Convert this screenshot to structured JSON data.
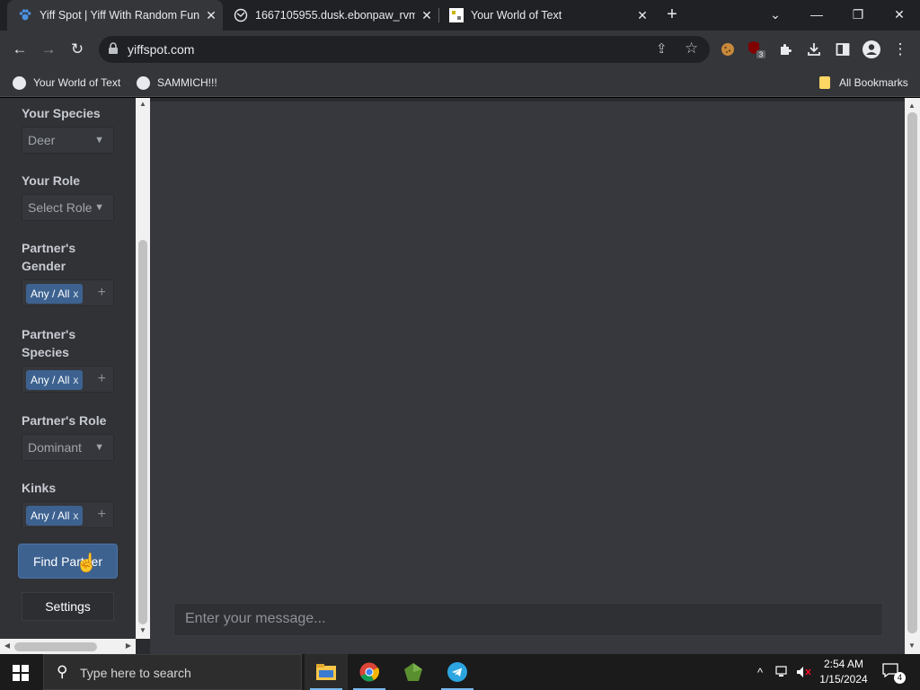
{
  "browser": {
    "tabs": [
      {
        "title": "Yiff Spot | Yiff With Random Fun",
        "icon": "paw-icon",
        "active": true
      },
      {
        "title": "1667105955.dusk.ebonpaw_rvm",
        "icon": "site-icon",
        "active": false
      },
      {
        "title": "Your World of Text",
        "icon": "ywot-icon",
        "active": false
      }
    ],
    "url": "yiffspot.com",
    "bookmarks": [
      {
        "label": "Your World of Text"
      },
      {
        "label": "SAMMICH!!!"
      }
    ],
    "all_bookmarks_label": "All Bookmarks",
    "extension_badge": "3"
  },
  "sidebar": {
    "your_species": {
      "label": "Your Species",
      "value": "Deer"
    },
    "your_role": {
      "label": "Your Role",
      "value": "Select Role"
    },
    "partner_gender": {
      "label": "Partner's Gender",
      "chip": "Any / All"
    },
    "partner_species": {
      "label": "Partner's Species",
      "chip": "Any / All"
    },
    "partner_role": {
      "label": "Partner's Role",
      "value": "Dominant"
    },
    "kinks": {
      "label": "Kinks",
      "chip": "Any / All"
    },
    "chip_remove": "x",
    "find_partner_label": "Find Partner",
    "settings_label": "Settings"
  },
  "chat": {
    "message_placeholder": "Enter your message..."
  },
  "taskbar": {
    "search_placeholder": "Type here to search",
    "time": "2:54 AM",
    "date": "1/15/2024",
    "notification_count": "4"
  },
  "colors": {
    "accent": "#3d6290",
    "sidebar_bg": "#303236",
    "chat_bg": "#36383d"
  }
}
